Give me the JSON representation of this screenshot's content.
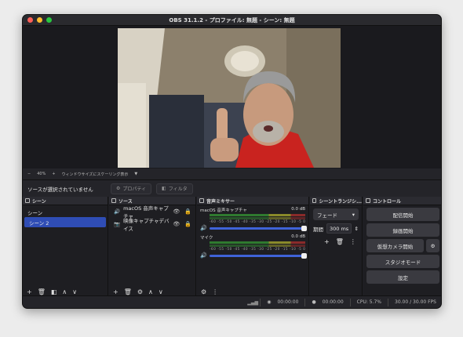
{
  "window": {
    "title": "OBS 31.1.2 - プロファイル: 無題 - シーン: 無題"
  },
  "preview": {
    "zoom_minus": "−",
    "zoom_level": "40%",
    "zoom_plus": "+",
    "scale_mode": "ウィンドウサイズにスケーリング表示",
    "scale_arrow": "▼"
  },
  "context": {
    "no_source": "ソースが選択されていません",
    "properties": "プロパティ",
    "filters": "フィルタ"
  },
  "scenes": {
    "title": "シーン",
    "items": [
      "シーン",
      "シーン 2"
    ],
    "selected_index": 1
  },
  "sources": {
    "title": "ソース",
    "items": [
      {
        "label": "macOS 音声キャプチャ",
        "icon": "speaker-icon"
      },
      {
        "label": "映像キャプチャデバイス",
        "icon": "camera-icon"
      }
    ]
  },
  "mixer": {
    "title": "音声ミキサー",
    "channels": [
      {
        "name": "macOS 音声キャプチャ",
        "db": "0.0 dB",
        "volume": 1.0
      },
      {
        "name": "マイク",
        "db": "0.0 dB",
        "volume": 1.0
      }
    ],
    "ticks": "-60 -55 -50 -45 -40 -35 -30 -25 -20 -15 -10 -5 0"
  },
  "transitions": {
    "title": "シーントランジシ...",
    "type": "フェード",
    "duration_label": "期間",
    "duration": "300 ms"
  },
  "controls": {
    "title": "コントロール",
    "start_stream": "配信開始",
    "start_record": "録画開始",
    "virtual_cam": "仮想カメラ開始",
    "studio_mode": "スタジオモード",
    "settings": "設定"
  },
  "status": {
    "stream_time": "00:00:00",
    "record_time": "00:00:00",
    "cpu": "CPU: 5.7%",
    "fps": "30.00 / 30.00 FPS"
  },
  "colors": {
    "accent": "#2f4db5",
    "slider": "#3f63d8",
    "bg": "#1f1f24"
  }
}
